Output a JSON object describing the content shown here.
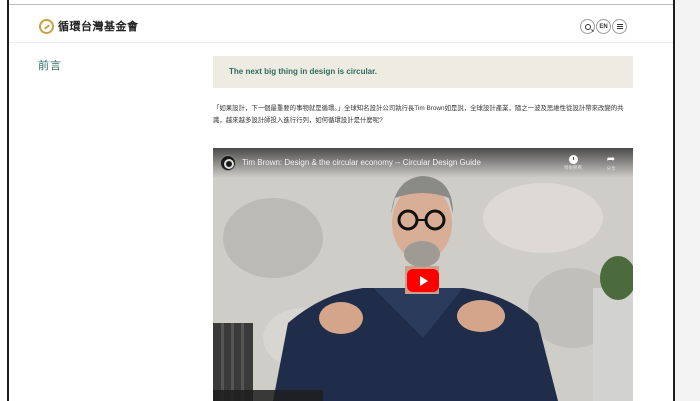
{
  "header": {
    "logo_text": "循環台灣基金會",
    "lang_label": "EN"
  },
  "section": {
    "title": "前言"
  },
  "quote": {
    "text": "The next big thing in design is circular."
  },
  "paragraph": "「如果設計，下一個最重要的事物就是循環。」全球知名設計公司執行長Tim Brown如是說，全球設計產業，隨之一波及思維性從設計帶來改變的共識，越來越多設計師投入進行行列，如何循環設計是什麼呢?",
  "video": {
    "title": "Tim Brown: Design & the circular economy -- Circular Design Guide",
    "watch_later_label": "稍後觀看",
    "share_label": "分享"
  },
  "colors": {
    "accent": "#2f6b62",
    "quote_bg": "#eeece2",
    "logo": "#c8a040",
    "play_button": "#ff0000"
  }
}
